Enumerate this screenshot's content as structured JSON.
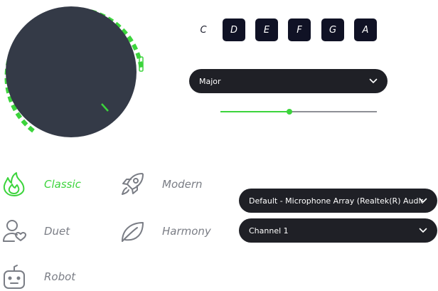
{
  "knob": {
    "value_percent": 72,
    "colors": {
      "body": "#343a47",
      "accent": "#3cd43c"
    }
  },
  "keys": [
    {
      "label": "C",
      "selected": true
    },
    {
      "label": "D",
      "selected": false
    },
    {
      "label": "E",
      "selected": false
    },
    {
      "label": "F",
      "selected": false
    },
    {
      "label": "G",
      "selected": false
    },
    {
      "label": "A",
      "selected": false
    }
  ],
  "scale": {
    "selected": "Major"
  },
  "slider": {
    "value_percent": 44
  },
  "modes": [
    {
      "label": "Classic",
      "icon": "flame-icon",
      "active": true
    },
    {
      "label": "Modern",
      "icon": "rocket-icon",
      "active": false
    },
    {
      "label": "Duet",
      "icon": "person-heart-icon",
      "active": false
    },
    {
      "label": "Harmony",
      "icon": "leaf-icon",
      "active": false
    },
    {
      "label": "Robot",
      "icon": "robot-icon",
      "active": false
    }
  ],
  "audio": {
    "input_device": "Default - Microphone Array (Realtek(R) Audio)",
    "channel": "Channel 1"
  },
  "colors": {
    "accent": "#3cd43c",
    "dark": "#1f2026",
    "muted": "#7a7d85"
  }
}
